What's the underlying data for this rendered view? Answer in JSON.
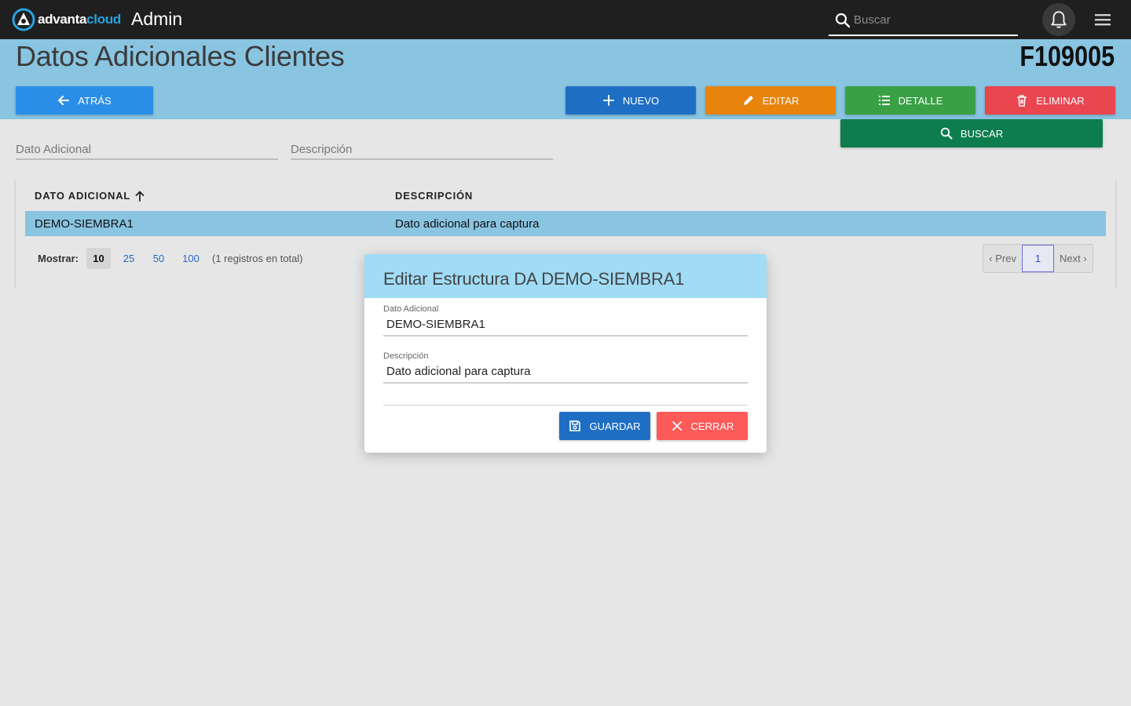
{
  "topbar": {
    "logo_text_1": "advanta",
    "logo_text_2": "cloud",
    "app_title": "Admin",
    "search_placeholder": "Buscar"
  },
  "header": {
    "title": "Datos Adicionales Clientes",
    "code": "F109005"
  },
  "actions": {
    "back": "ATRÁS",
    "new": "NUEVO",
    "edit": "EDITAR",
    "detail": "DETALLE",
    "delete": "ELIMINAR",
    "search": "BUSCAR"
  },
  "filters": {
    "dato_adicional_placeholder": "Dato Adicional",
    "descripcion_placeholder": "Descripción"
  },
  "table": {
    "columns": [
      "DATO ADICIONAL",
      "DESCRIPCIÓN"
    ],
    "sort_column": "DATO ADICIONAL",
    "sort_direction": "asc",
    "rows": [
      [
        "DEMO-SIEMBRA1",
        "Dato adicional para captura"
      ]
    ]
  },
  "pagination": {
    "show_label": "Mostrar:",
    "page_sizes": [
      "10",
      "25",
      "50",
      "100"
    ],
    "selected_page_size": "10",
    "total_text": "(1 registros en total)",
    "prev": "‹ Prev",
    "current_page": "1",
    "next": "Next ›"
  },
  "modal": {
    "title": "Editar Estructura DA DEMO-SIEMBRA1",
    "field_1_label": "Dato Adicional",
    "field_1_value": "DEMO-SIEMBRA1",
    "field_2_label": "Descripción",
    "field_2_value": "Dato adicional para captura",
    "save": "GUARDAR",
    "close": "CERRAR"
  },
  "colors": {
    "topbar": "#1f1f1f",
    "band": "#89c4e1",
    "modal_header": "#a0dcf6",
    "new": "#1e6fc4",
    "edit": "#e8830c",
    "detail": "#3aa046",
    "delete": "#e94650",
    "search": "#0e7d4e",
    "close": "#fd5a5a"
  }
}
